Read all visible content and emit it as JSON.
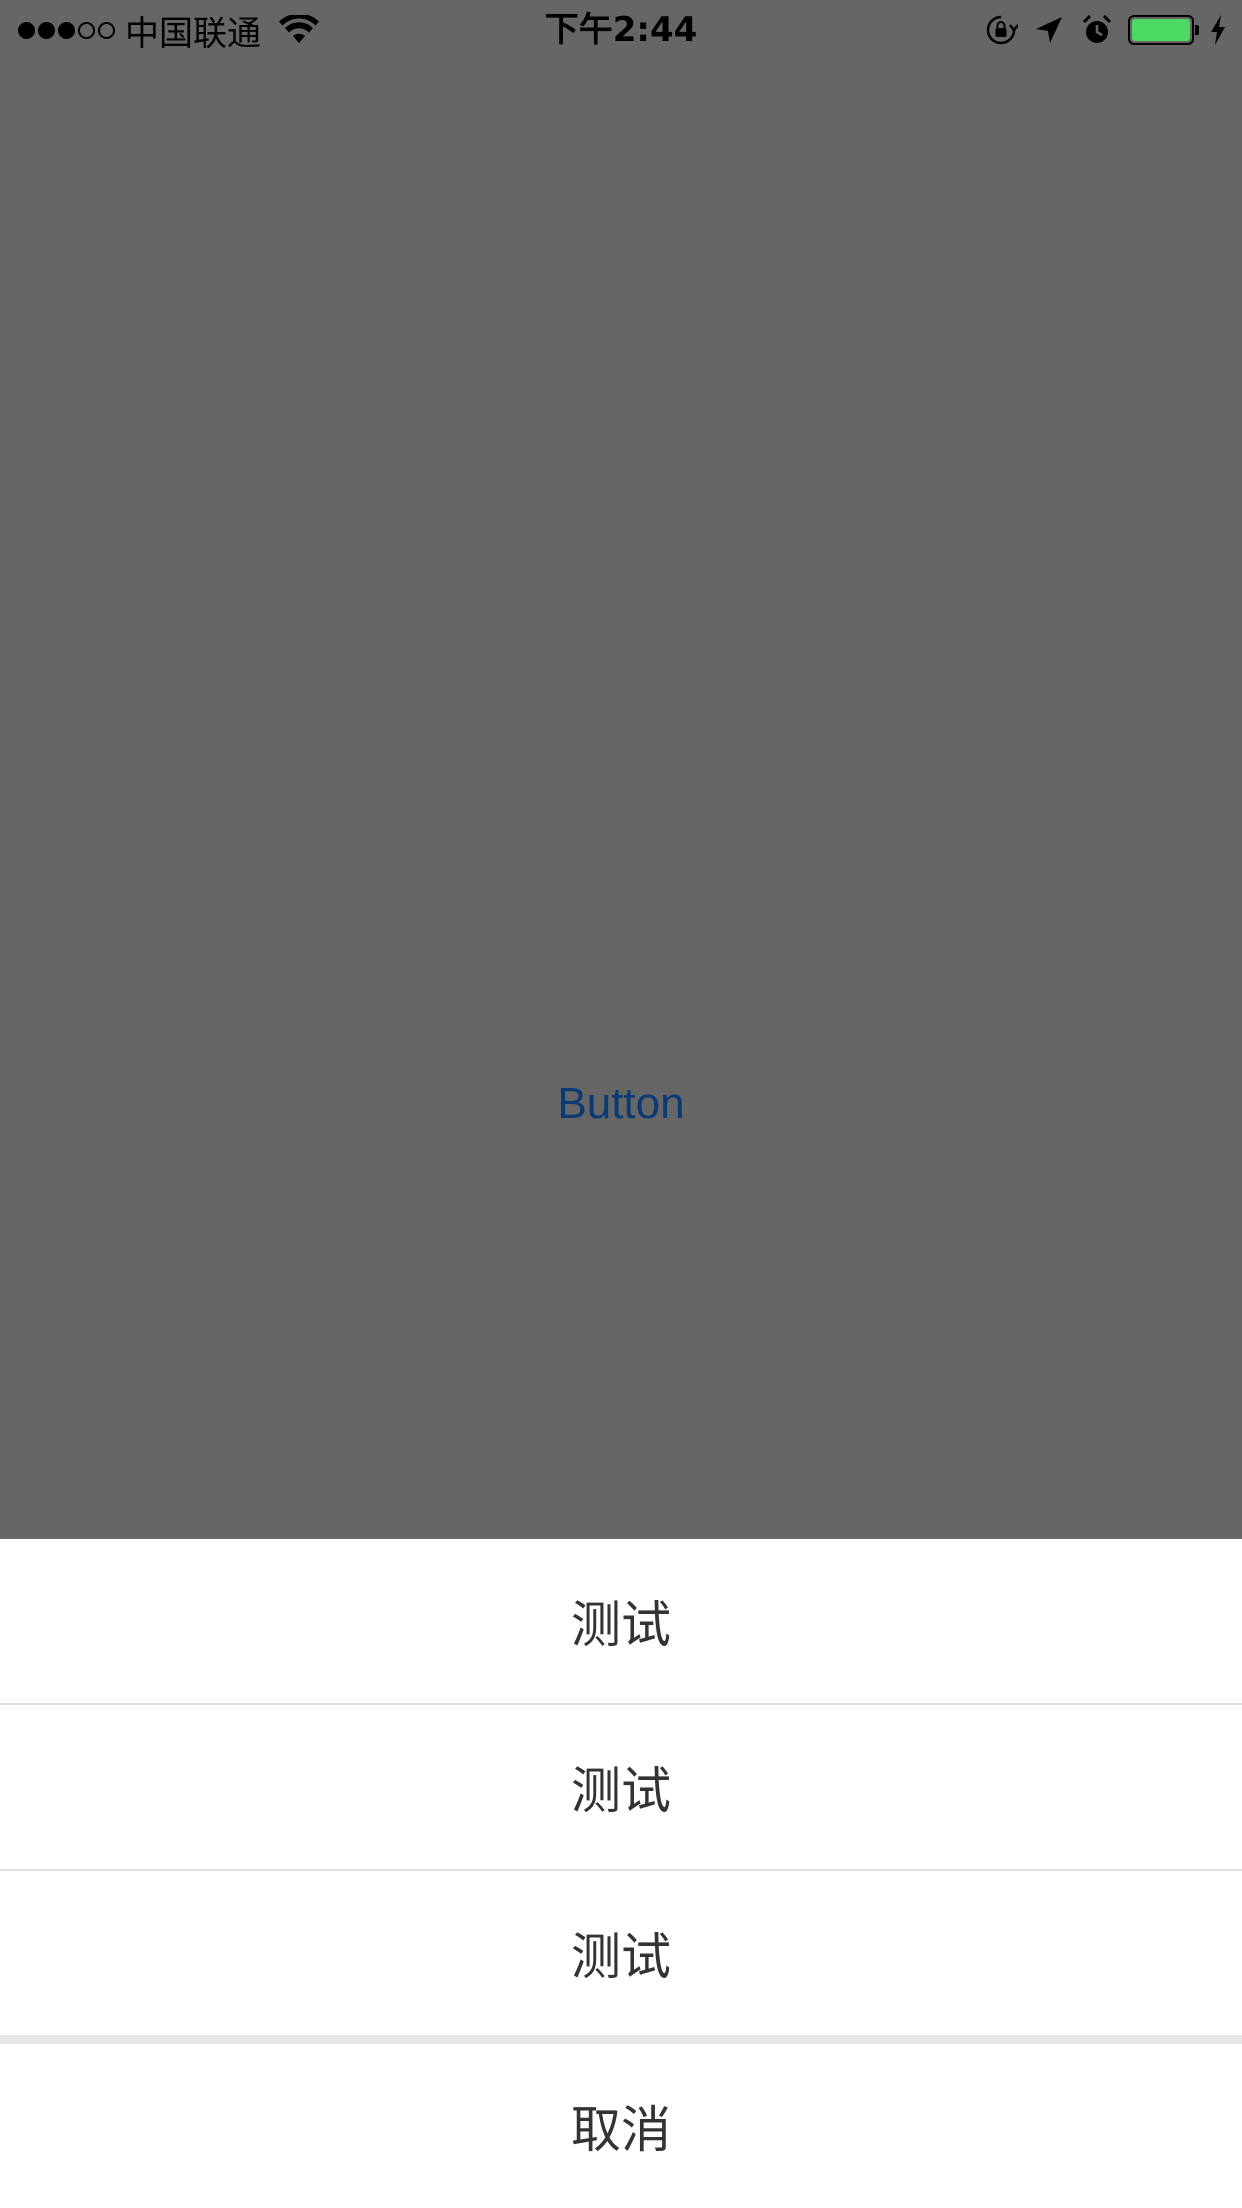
{
  "status_bar": {
    "carrier": "中国联通",
    "time": "下午2:44",
    "signal_bars_filled": 3,
    "signal_bars_total": 5,
    "icons": [
      "wifi-icon",
      "orientation-lock-icon",
      "location-arrow-icon",
      "alarm-icon",
      "battery-icon",
      "charging-bolt-icon"
    ],
    "battery_color": "#4cd964"
  },
  "main": {
    "button_label": "Button",
    "button_color": "#0b3a74",
    "background_color": "#666666"
  },
  "action_sheet": {
    "items": [
      {
        "label": "测试"
      },
      {
        "label": "测试"
      },
      {
        "label": "测试"
      }
    ],
    "cancel_label": "取消"
  }
}
